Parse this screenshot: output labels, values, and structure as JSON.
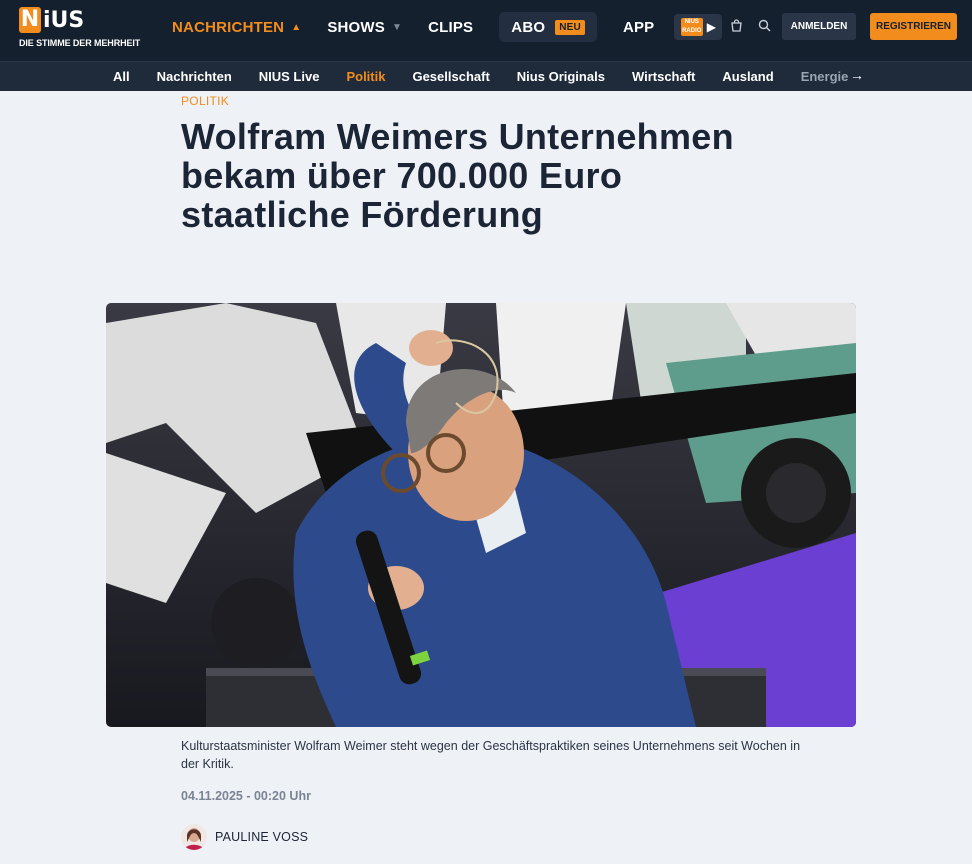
{
  "brand": {
    "logo_letter": "N",
    "logo_rest": "iUS",
    "tagline": "DIE STIMME DER MEHRHEIT",
    "accent": "#f28c1c",
    "header_bg": "#15202e"
  },
  "mainnav": {
    "items": [
      {
        "label": "NACHRICHTEN",
        "active": true,
        "dropdown": true
      },
      {
        "label": "SHOWS",
        "dropdown": true
      },
      {
        "label": "CLIPS"
      },
      {
        "label": "ABO",
        "badge": "NEU"
      },
      {
        "label": "APP"
      }
    ],
    "radio": {
      "label_top": "NIUS",
      "label_bottom": "RADIO"
    }
  },
  "header_icons": [
    "bag-icon",
    "search-icon"
  ],
  "auth": {
    "login": "ANMELDEN",
    "register": "REGISTRIEREN"
  },
  "subnav": {
    "items": [
      "All",
      "Nachrichten",
      "NIUS Live",
      "Politik",
      "Gesellschaft",
      "Nius Originals",
      "Wirtschaft",
      "Ausland",
      "Energie"
    ],
    "active": "Politik"
  },
  "article": {
    "kicker": "POLITIK",
    "headline": "Wolfram Weimers Unternehmen bekam über 700.000 Euro staatliche Förderung",
    "caption": "Kulturstaatsminister Wolfram Weimer steht wegen der Geschäftspraktiken seines Unternehmens seit Wochen in der Kritik.",
    "date": "04.11.2025 - 00:20 Uhr",
    "author": "PAULINE VOSS"
  }
}
